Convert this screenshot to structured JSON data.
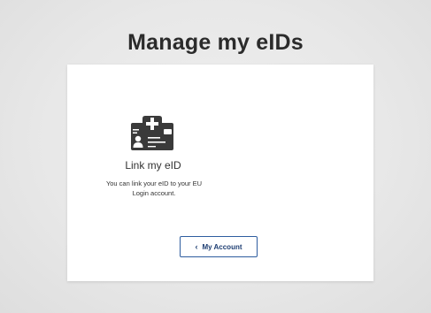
{
  "page": {
    "title": "Manage my eIDs"
  },
  "card": {
    "icon": "eid-card-plus-icon",
    "link_title": "Link my eID",
    "link_description": "You can link your eID to your EU Login account."
  },
  "button": {
    "icon": "chevron-left-icon",
    "chevron": "‹",
    "label": "My Account"
  },
  "colors": {
    "background": "#e6e6e6",
    "card": "#ffffff",
    "icon": "#3a3a3a",
    "button_border": "#2e5d9f",
    "button_text": "#1f3f73"
  }
}
